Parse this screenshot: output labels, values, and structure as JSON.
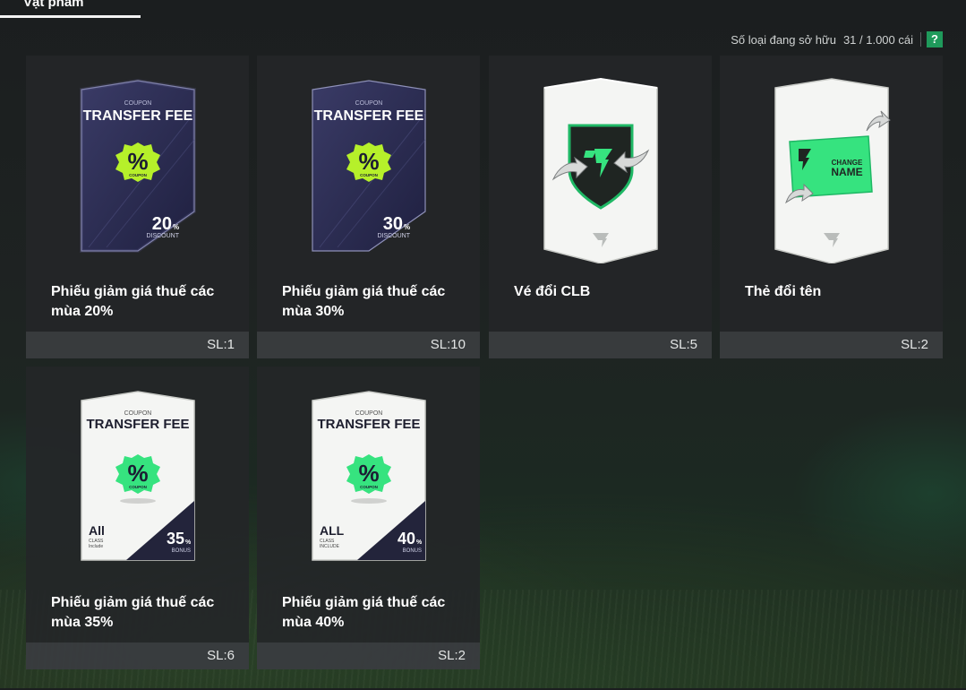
{
  "tab": {
    "label": "Vật phẩm"
  },
  "ownership": {
    "label": "Số loại đang sở hữu",
    "count": "31 / 1.000 cái",
    "help": "?"
  },
  "colors": {
    "accent": "#1f9a5b",
    "neon_green": "#36e37f",
    "lime": "#b6f02a",
    "navy": "#2b2c4e"
  },
  "items": [
    {
      "name": "Phiếu giảm giá thuế các mùa 20%",
      "qty": "SL:1",
      "icon": "transfer-fee-coupon-dark-icon",
      "card": {
        "coupon": "COUPON",
        "title": "TRANSFER FEE",
        "badge": "%",
        "badge_sub": "COUPON",
        "value": "20",
        "unit": "%",
        "caption": "DISCOUNT"
      }
    },
    {
      "name": "Phiếu giảm giá thuế các mùa 30%",
      "qty": "SL:10",
      "icon": "transfer-fee-coupon-dark-icon",
      "card": {
        "coupon": "COUPON",
        "title": "TRANSFER FEE",
        "badge": "%",
        "badge_sub": "COUPON",
        "value": "30",
        "unit": "%",
        "caption": "DISCOUNT"
      }
    },
    {
      "name": "Vé đổi CLB",
      "qty": "SL:5",
      "icon": "club-change-ticket-icon"
    },
    {
      "name": "Thẻ đổi tên",
      "qty": "SL:2",
      "icon": "name-change-card-icon",
      "card": {
        "line1": "CHANGE",
        "line2": "NAME"
      }
    },
    {
      "name": "Phiếu giảm giá thuế các mùa 35%",
      "qty": "SL:6",
      "icon": "transfer-fee-coupon-light-icon",
      "card": {
        "coupon": "COUPON",
        "title": "TRANSFER FEE",
        "badge": "%",
        "badge_sub": "COUPON",
        "value": "35",
        "unit": "%",
        "caption": "BONUS",
        "class_main": "All",
        "class_sub1": "CLASS",
        "class_sub2": "Include"
      }
    },
    {
      "name": "Phiếu giảm giá thuế các mùa 40%",
      "qty": "SL:2",
      "icon": "transfer-fee-coupon-light-icon",
      "card": {
        "coupon": "COUPON",
        "title": "TRANSFER FEE",
        "badge": "%",
        "badge_sub": "COUPON",
        "value": "40",
        "unit": "%",
        "caption": "BONUS",
        "class_main": "ALL",
        "class_sub1": "CLASS",
        "class_sub2": "INCLUDE"
      }
    }
  ]
}
